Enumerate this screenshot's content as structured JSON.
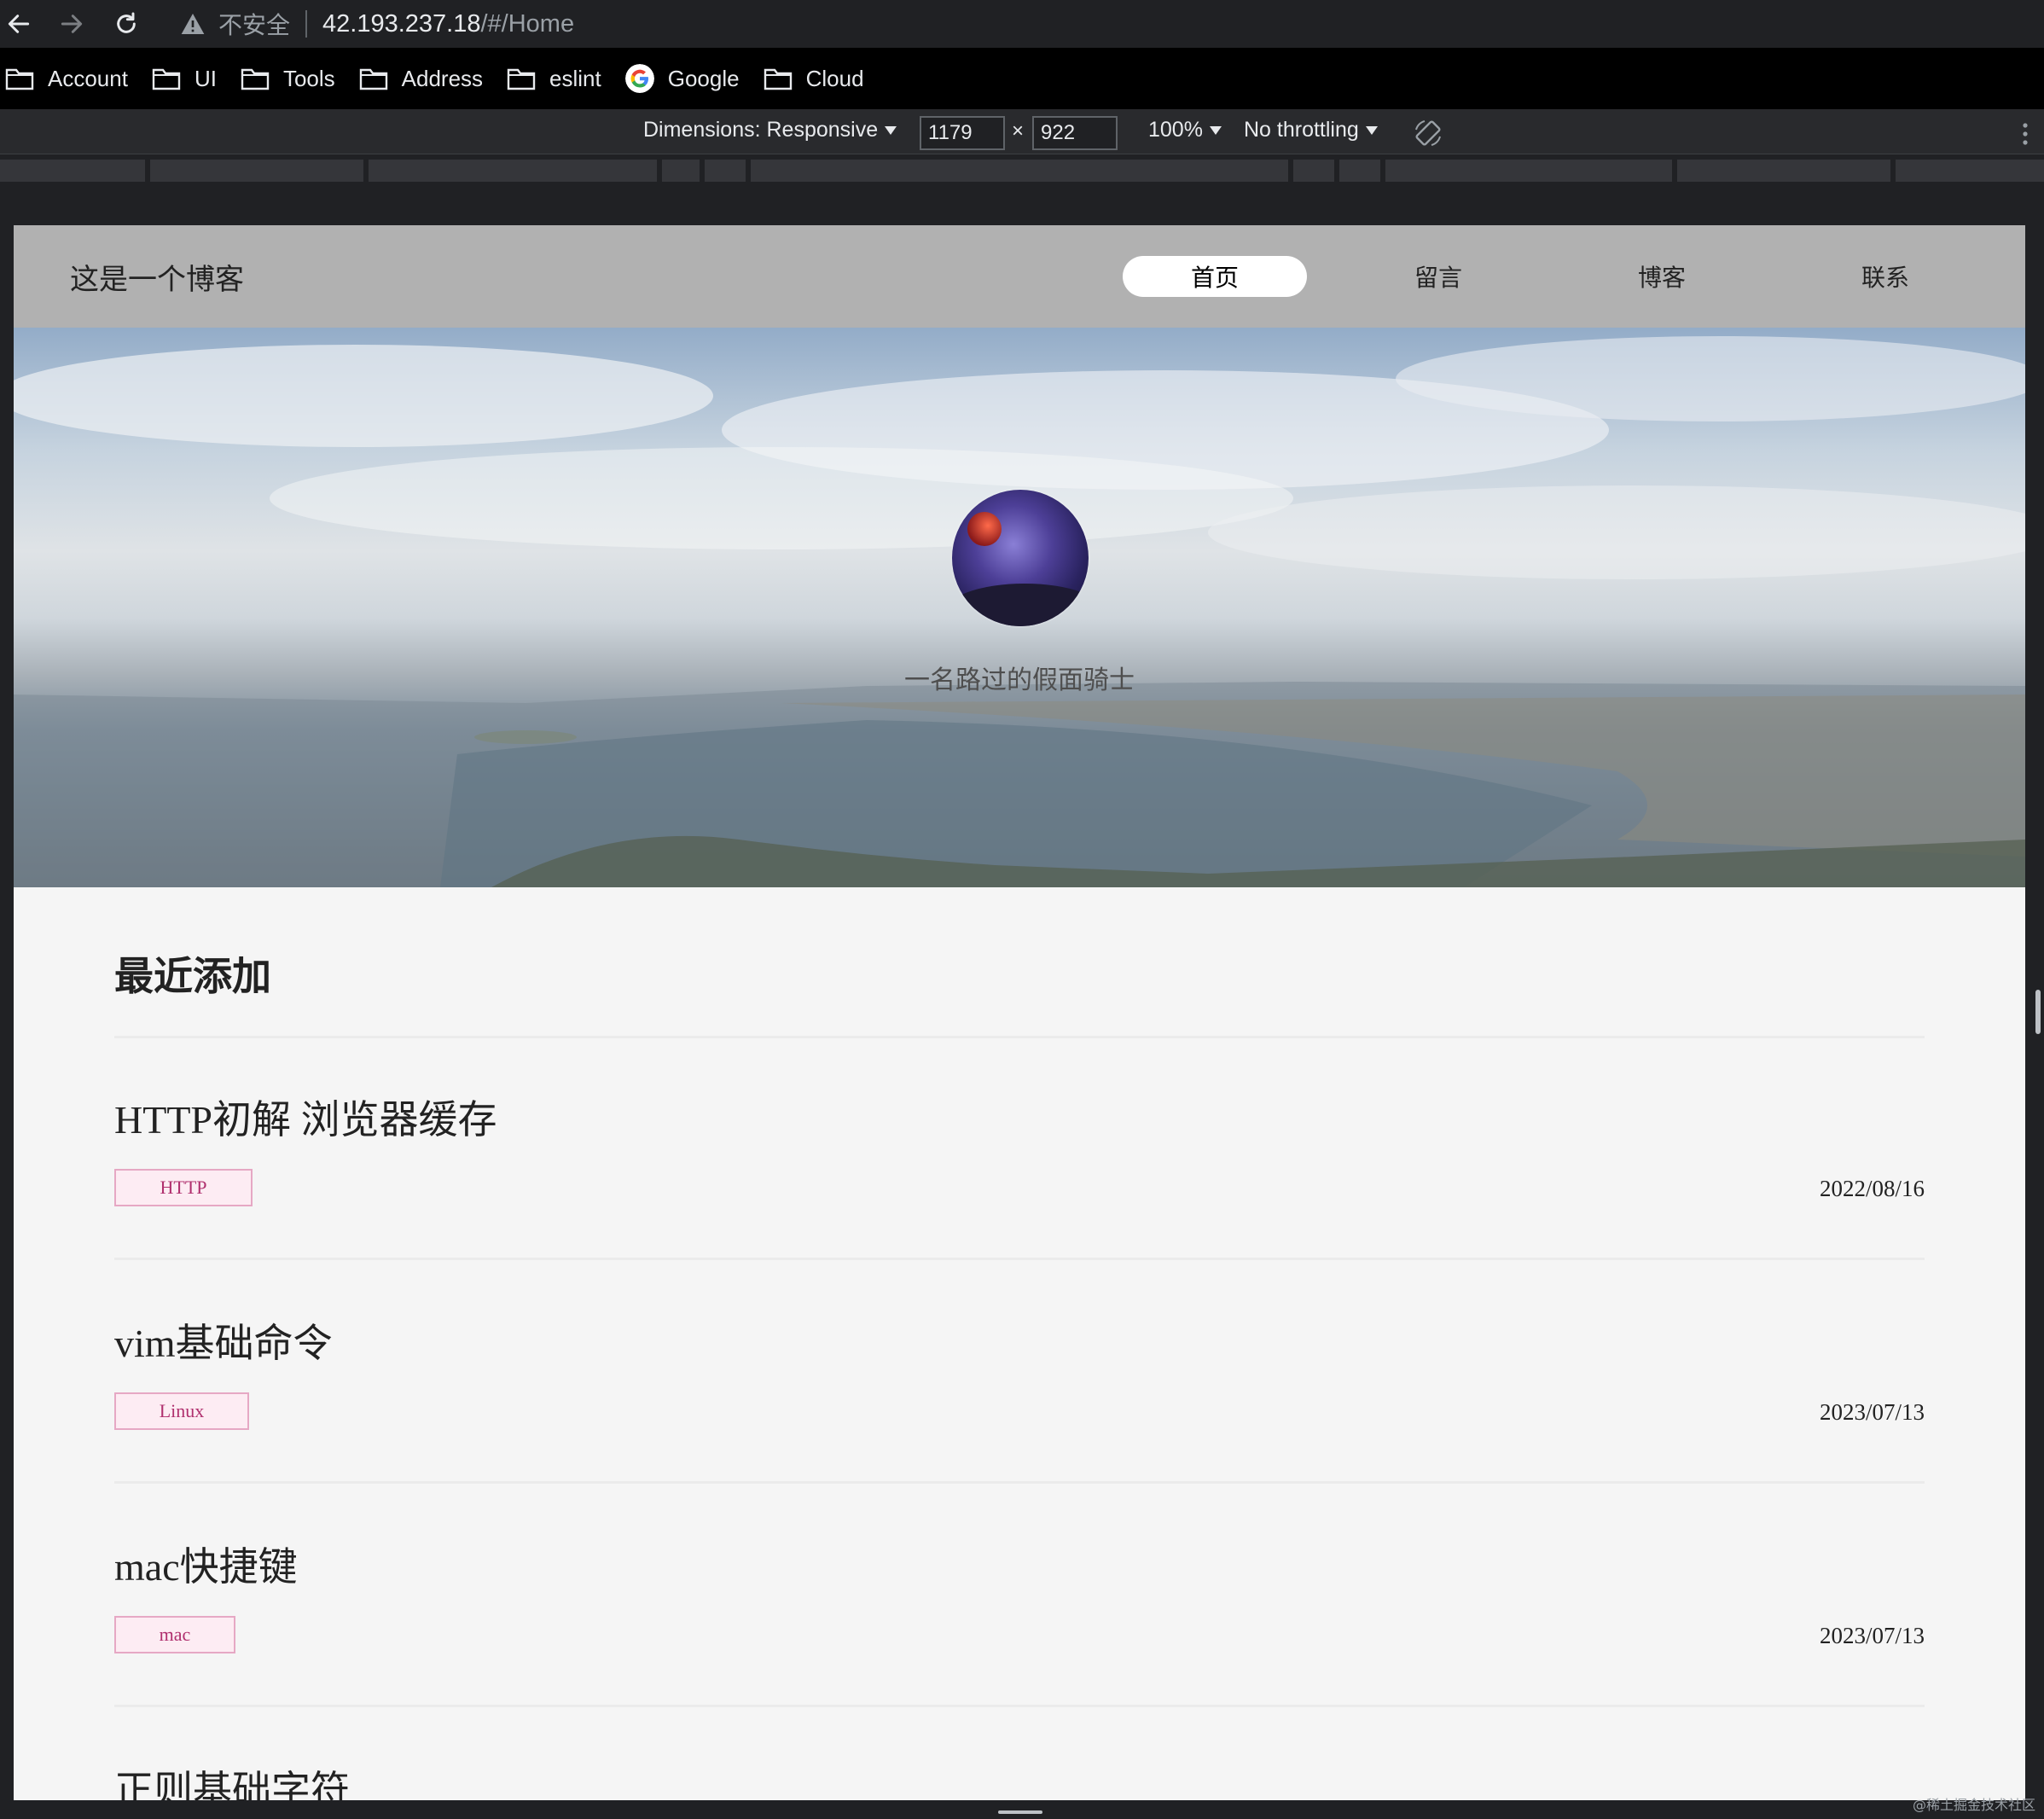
{
  "browser": {
    "security_label": "不安全",
    "url_host": "42.193.237.18",
    "url_path": "/#/Home",
    "bookmarks": [
      {
        "label": "Account",
        "icon": "folder-icon"
      },
      {
        "label": "UI",
        "icon": "folder-icon"
      },
      {
        "label": "Tools",
        "icon": "folder-icon"
      },
      {
        "label": "Address",
        "icon": "folder-icon"
      },
      {
        "label": "eslint",
        "icon": "folder-icon"
      },
      {
        "label": "Google",
        "icon": "google-icon"
      },
      {
        "label": "Cloud",
        "icon": "folder-icon"
      }
    ]
  },
  "devtools": {
    "dimensions_label": "Dimensions: Responsive",
    "width_value": "1179",
    "height_value": "922",
    "times": "×",
    "zoom_label": "100%",
    "throttling_label": "No throttling"
  },
  "site": {
    "title": "这是一个博客",
    "nav": [
      {
        "label": "首页",
        "active": true
      },
      {
        "label": "留言",
        "active": false
      },
      {
        "label": "博客",
        "active": false
      },
      {
        "label": "联系",
        "active": false
      }
    ],
    "motto": "一名路过的假面骑士",
    "section_title": "最近添加",
    "posts": [
      {
        "title": "HTTP初解 浏览器缓存",
        "tag": "HTTP",
        "date": "2022/08/16"
      },
      {
        "title": "vim基础命令",
        "tag": "Linux",
        "date": "2023/07/13"
      },
      {
        "title": "mac快捷键",
        "tag": "mac",
        "date": "2023/07/13"
      },
      {
        "title": "正则基础字符",
        "tag": "",
        "date": ""
      }
    ]
  },
  "watermark": "@稀土掘金技术社区",
  "colors": {
    "tag_border": "#e6a8c4",
    "tag_bg": "#fdecf3",
    "tag_text": "#b0306e",
    "header_bg": "#b1b1b1"
  }
}
